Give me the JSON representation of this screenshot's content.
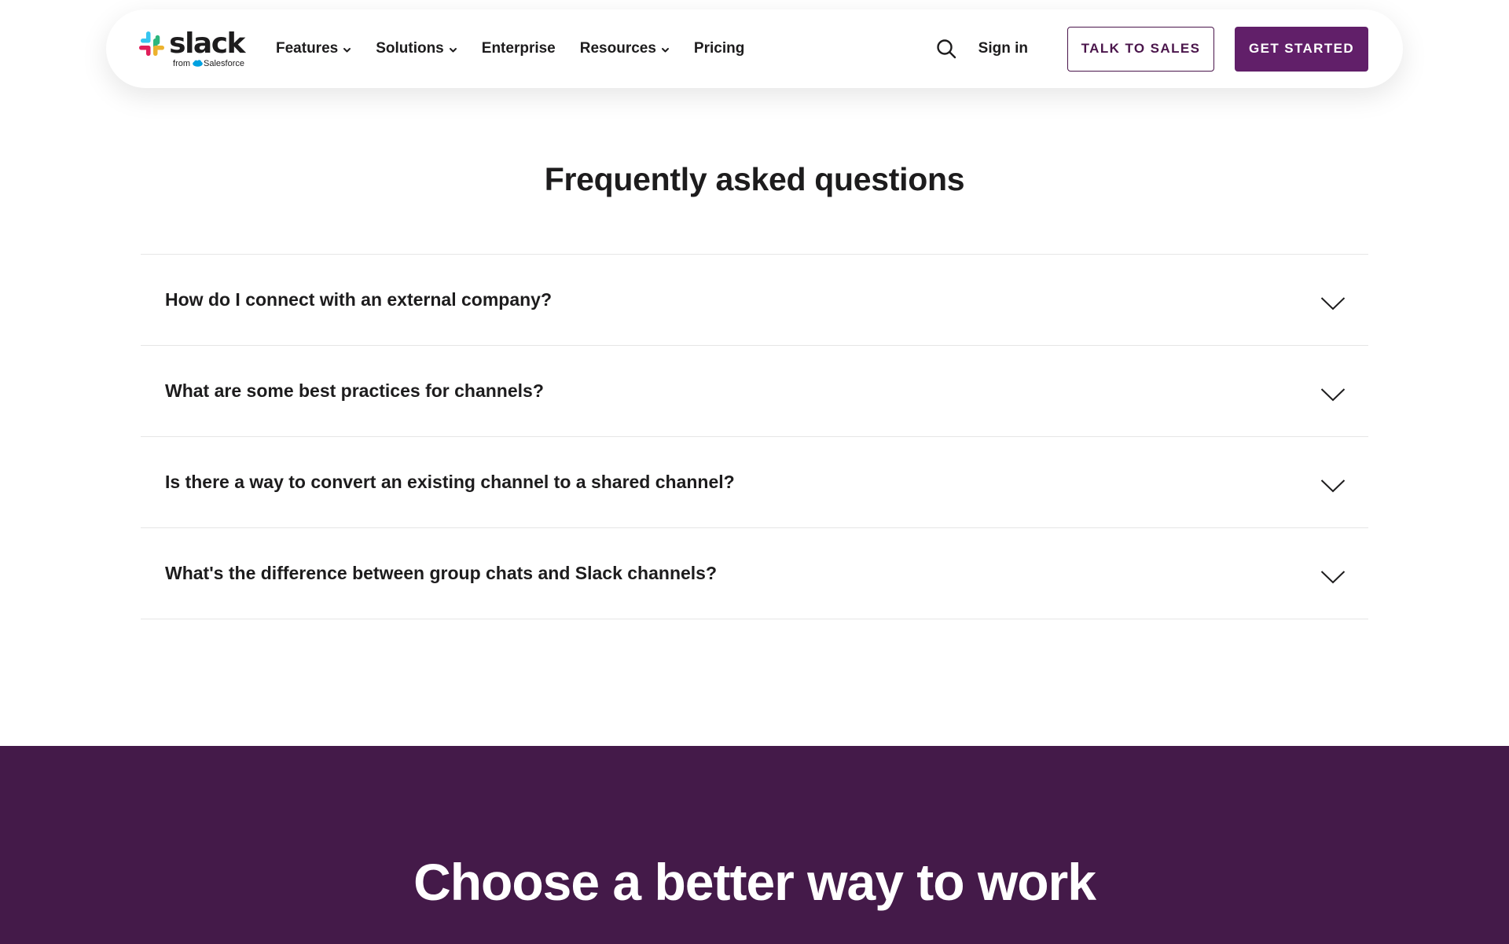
{
  "header": {
    "logo": {
      "wordmark": "slack",
      "sub_prefix": "from",
      "sub_brand": "Salesforce"
    },
    "nav": [
      {
        "label": "Features",
        "has_dropdown": true,
        "icon": "chevron-down-icon"
      },
      {
        "label": "Solutions",
        "has_dropdown": true,
        "icon": "chevron-down-icon"
      },
      {
        "label": "Enterprise",
        "has_dropdown": false
      },
      {
        "label": "Resources",
        "has_dropdown": true,
        "icon": "chevron-down-icon"
      },
      {
        "label": "Pricing",
        "has_dropdown": false
      }
    ],
    "search_icon": "search-icon",
    "sign_in": "Sign in",
    "talk_to_sales": "TALK TO SALES",
    "get_started": "GET STARTED"
  },
  "faq": {
    "title": "Frequently asked questions",
    "items": [
      {
        "question": "How do I connect with an external company?",
        "icon": "chevron-down-icon"
      },
      {
        "question": "What are some best practices for channels?",
        "icon": "chevron-down-icon"
      },
      {
        "question": "Is there a way to convert an existing channel to a shared channel?",
        "icon": "chevron-down-icon"
      },
      {
        "question": "What's the difference between group chats and Slack channels?",
        "icon": "chevron-down-icon"
      }
    ]
  },
  "cta": {
    "title": "Choose a better way to work"
  },
  "colors": {
    "brand_purple": "#611f69",
    "outline_purple": "#4a154b",
    "cta_background": "#441a49",
    "text": "#1d1c1d",
    "divider": "#e6e6e6",
    "logo_blue": "#36c5f0",
    "logo_green": "#2eb67d",
    "logo_yellow": "#ecb22e",
    "logo_red": "#e01e5a",
    "salesforce_blue": "#00a1e0"
  }
}
